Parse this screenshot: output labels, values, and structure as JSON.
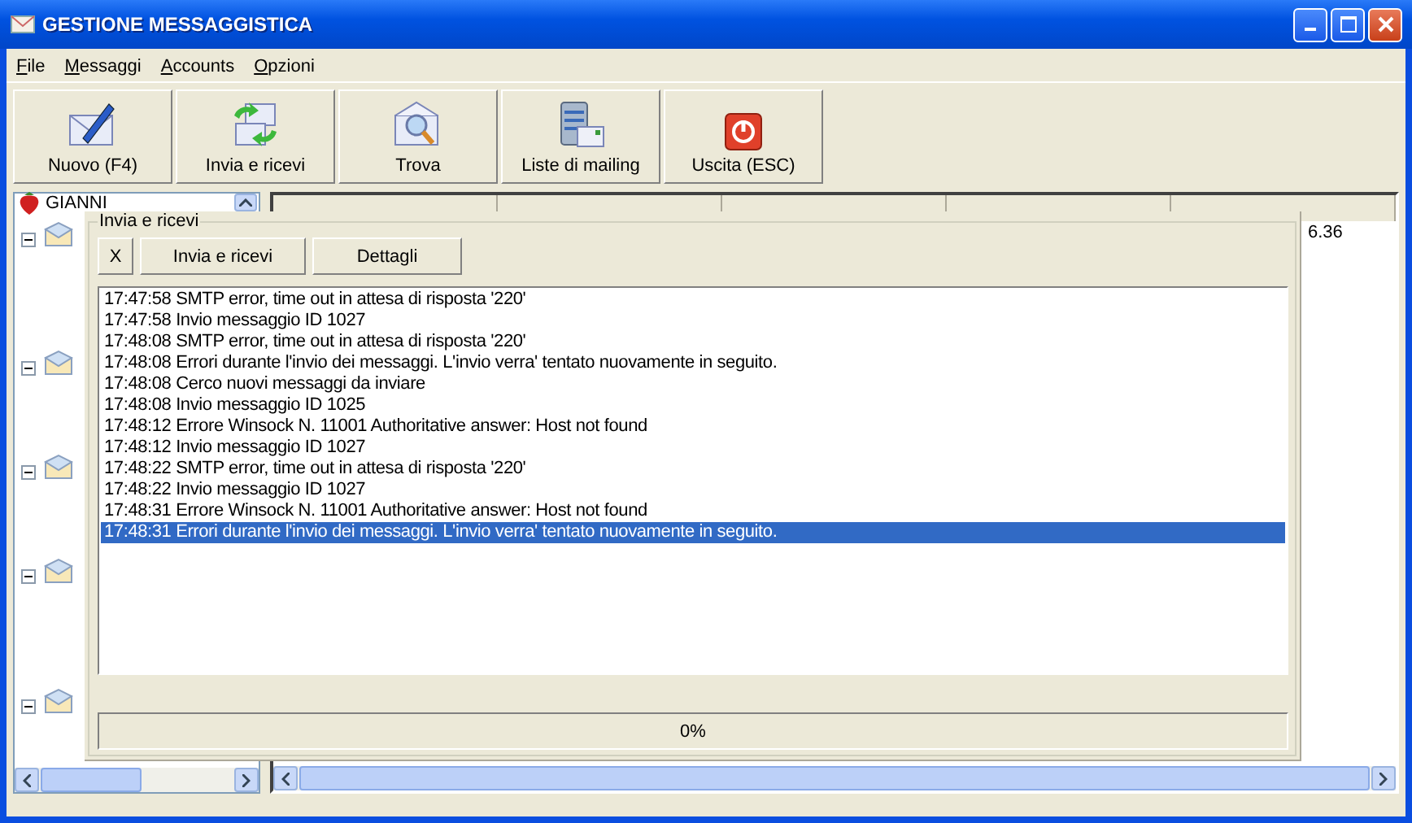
{
  "window": {
    "title": "GESTIONE MESSAGGISTICA"
  },
  "menu": [
    "File",
    "Messaggi",
    "Accounts",
    "Opzioni"
  ],
  "toolbar": [
    {
      "label": "Nuovo (F4)",
      "kind": "new"
    },
    {
      "label": "Invia e ricevi",
      "kind": "sendreceive"
    },
    {
      "label": "Trova",
      "kind": "find"
    },
    {
      "label": "Liste di mailing",
      "kind": "lists"
    },
    {
      "label": "Uscita (ESC)",
      "kind": "exit"
    }
  ],
  "tree": {
    "root": "GIANNI"
  },
  "message_list": {
    "rows": [
      {
        "column_5": "6.36"
      }
    ]
  },
  "send_receive_panel": {
    "title": "Invia e ricevi",
    "buttons": [
      "X",
      "Invia e ricevi",
      "Dettagli"
    ],
    "log": [
      {
        "text": "17:47:58 SMTP error, time out in attesa di risposta '220'",
        "selected": false
      },
      {
        "text": "17:47:58 Invio messaggio ID 1027",
        "selected": false
      },
      {
        "text": "17:48:08 SMTP error, time out in attesa di risposta '220'",
        "selected": false
      },
      {
        "text": "17:48:08 Errori durante l'invio dei messaggi. L'invio verra' tentato nuovamente in seguito.",
        "selected": false
      },
      {
        "text": "17:48:08 Cerco nuovi messaggi da inviare",
        "selected": false
      },
      {
        "text": "17:48:08 Invio messaggio ID 1025",
        "selected": false
      },
      {
        "text": "17:48:12 Errore Winsock N. 11001 Authoritative answer: Host not found",
        "selected": false
      },
      {
        "text": "17:48:12 Invio messaggio ID 1027",
        "selected": false
      },
      {
        "text": "17:48:22 SMTP error, time out in attesa di risposta '220'",
        "selected": false
      },
      {
        "text": "17:48:22 Invio messaggio ID 1027",
        "selected": false
      },
      {
        "text": "17:48:31 Errore Winsock N. 11001 Authoritative answer: Host not found",
        "selected": false
      },
      {
        "text": "17:48:31 Errori durante l'invio dei messaggi. L'invio verra' tentato nuovamente in seguito.",
        "selected": true
      }
    ],
    "progress": {
      "level": 0,
      "reading": "0%"
    }
  }
}
